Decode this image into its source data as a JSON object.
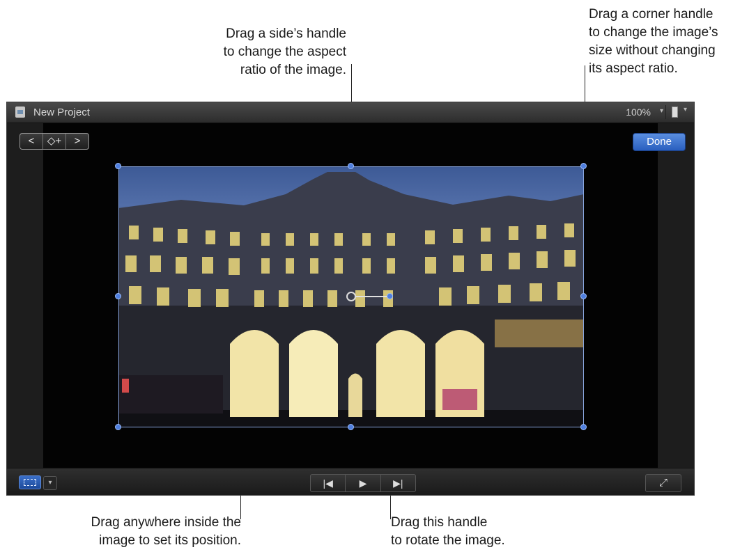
{
  "callouts": {
    "side_handle": [
      "Drag a side’s handle",
      "to change the aspect",
      "ratio of the image."
    ],
    "corner_handle": [
      "Drag a corner handle",
      "to change the image’s",
      "size without changing",
      "its aspect ratio."
    ],
    "drag_inside": [
      "Drag anywhere inside the",
      "image to set its position."
    ],
    "rotate_handle": [
      "Drag this handle",
      "to rotate the image."
    ]
  },
  "viewer": {
    "project_title": "New Project",
    "zoom_label": "100%",
    "done_label": "Done",
    "nav": {
      "back": "<",
      "keyframe": "◇+",
      "forward": ">"
    },
    "transport": {
      "prev": "|◀",
      "play": "▶",
      "next": "▶|"
    },
    "fullscreen": "⤢",
    "caret": "▾"
  },
  "colors": {
    "accent": "#4f7fdf",
    "done_button": "#2a5fbf",
    "sky": "#3d5a96"
  }
}
